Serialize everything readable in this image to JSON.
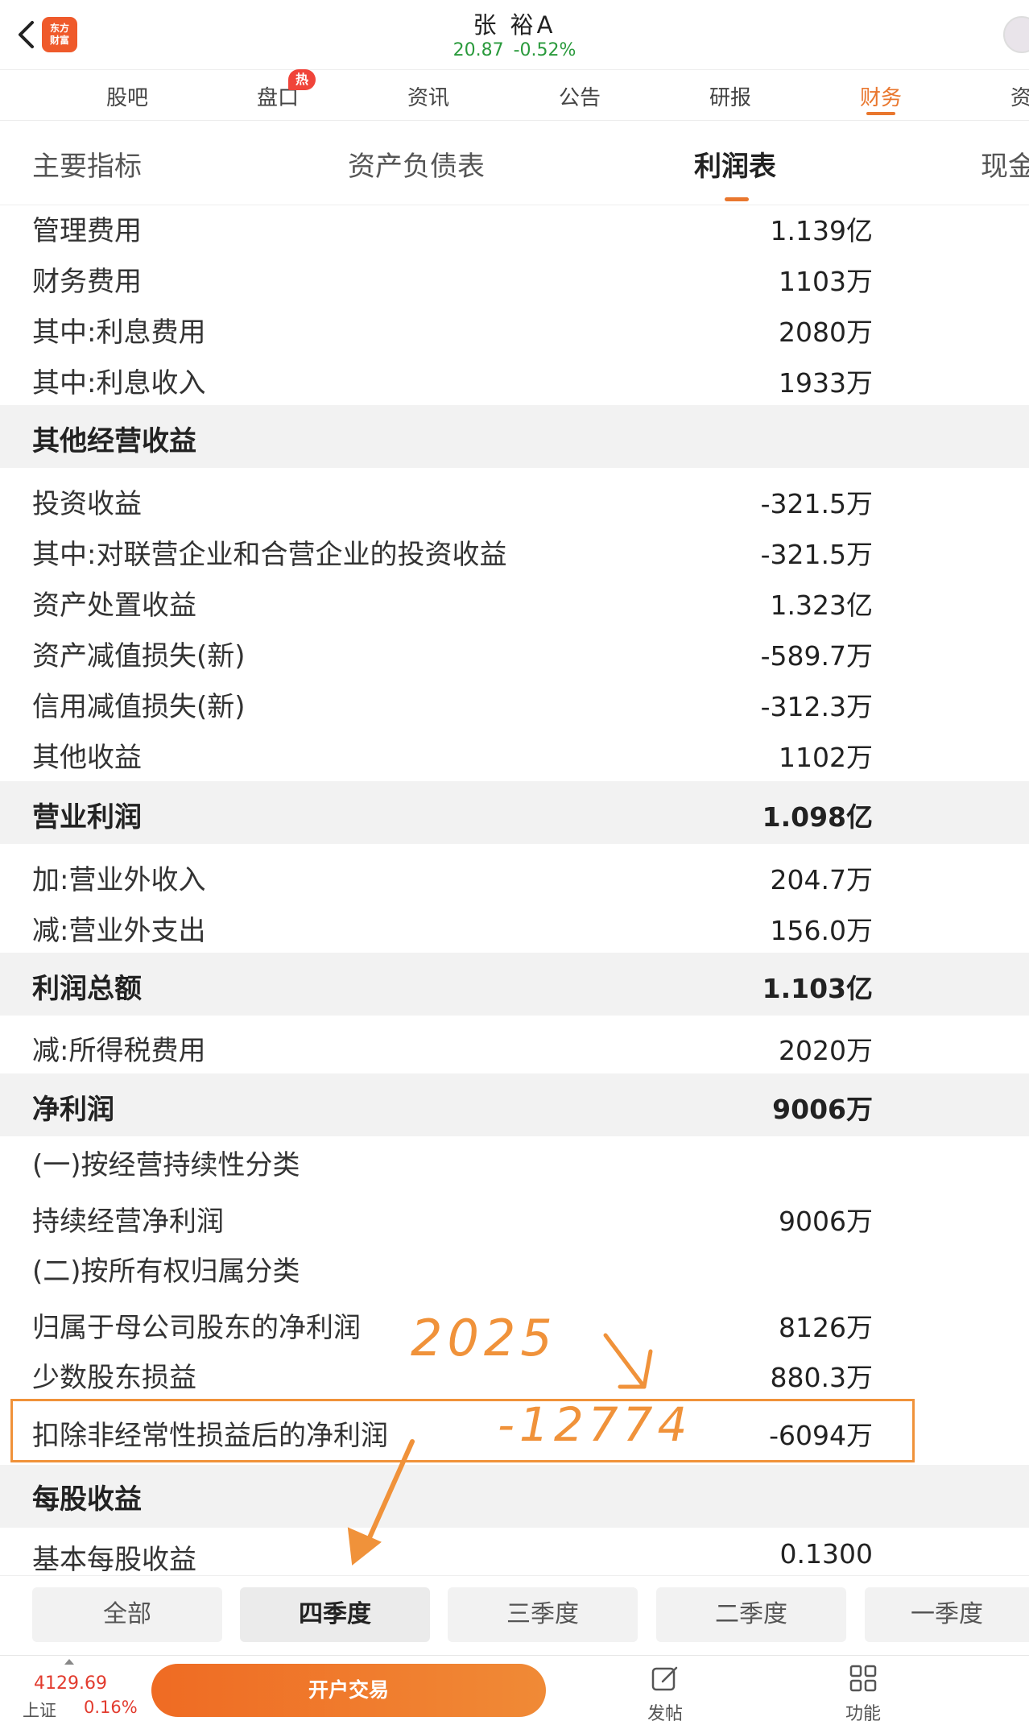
{
  "header": {
    "stock_name": "张 裕A",
    "price": "20.87",
    "change": "-0.52%",
    "logo_text": "东方财富"
  },
  "main_tabs": [
    {
      "label": "股吧"
    },
    {
      "label": "盘口",
      "badge": "热"
    },
    {
      "label": "资讯"
    },
    {
      "label": "公告"
    },
    {
      "label": "研报"
    },
    {
      "label": "财务",
      "active": true
    },
    {
      "label": "资"
    }
  ],
  "sub_tabs": [
    {
      "label": "主要指标"
    },
    {
      "label": "资产负债表"
    },
    {
      "label": "利润表",
      "active": true
    },
    {
      "label": "现金"
    }
  ],
  "rows": [
    {
      "label": "管理费用",
      "value": "1.139亿"
    },
    {
      "label": "财务费用",
      "value": "1103万"
    },
    {
      "label": "其中:利息费用",
      "value": "2080万"
    },
    {
      "label": "其中:利息收入",
      "value": "1933万"
    },
    {
      "label": "其他经营收益",
      "value": "",
      "section": true
    },
    {
      "label": "投资收益",
      "value": "-321.5万"
    },
    {
      "label": "其中:对联营企业和合营企业的投资收益",
      "value": "-321.5万"
    },
    {
      "label": "资产处置收益",
      "value": "1.323亿"
    },
    {
      "label": "资产减值损失(新)",
      "value": "-589.7万"
    },
    {
      "label": "信用减值损失(新)",
      "value": "-312.3万"
    },
    {
      "label": "其他收益",
      "value": "1102万"
    },
    {
      "label": "营业利润",
      "value": "1.098亿",
      "section": true
    },
    {
      "label": "加:营业外收入",
      "value": "204.7万"
    },
    {
      "label": "减:营业外支出",
      "value": "156.0万"
    },
    {
      "label": "利润总额",
      "value": "1.103亿",
      "section": true
    },
    {
      "label": "减:所得税费用",
      "value": "2020万"
    },
    {
      "label": "净利润",
      "value": "9006万",
      "section": true
    },
    {
      "label": "(一)按经营持续性分类",
      "value": ""
    },
    {
      "label": "持续经营净利润",
      "value": "9006万"
    },
    {
      "label": "(二)按所有权归属分类",
      "value": ""
    },
    {
      "label": "归属于母公司股东的净利润",
      "value": "8126万"
    },
    {
      "label": "少数股东损益",
      "value": "880.3万"
    },
    {
      "label": "扣除非经常性损益后的净利润",
      "value": "-6094万"
    },
    {
      "label": "每股收益",
      "value": "",
      "section": true
    },
    {
      "label": "基本每股收益",
      "value": "0.1300"
    }
  ],
  "annotations": {
    "year_note": "2025",
    "value_note": "-12774"
  },
  "period_tabs": [
    {
      "label": "全部"
    },
    {
      "label": "四季度",
      "active": true
    },
    {
      "label": "三季度"
    },
    {
      "label": "二季度"
    },
    {
      "label": "一季度"
    }
  ],
  "bottom_bar": {
    "index_value": "4129.69",
    "index_name": "上证",
    "index_change": "0.16%",
    "open_button": "开户交易",
    "post_label": "发帖",
    "function_label": "功能"
  },
  "colors": {
    "accent": "#e9772e",
    "up": "#e23b2e",
    "down": "#2a9a3c",
    "annotation": "#f0923a"
  }
}
